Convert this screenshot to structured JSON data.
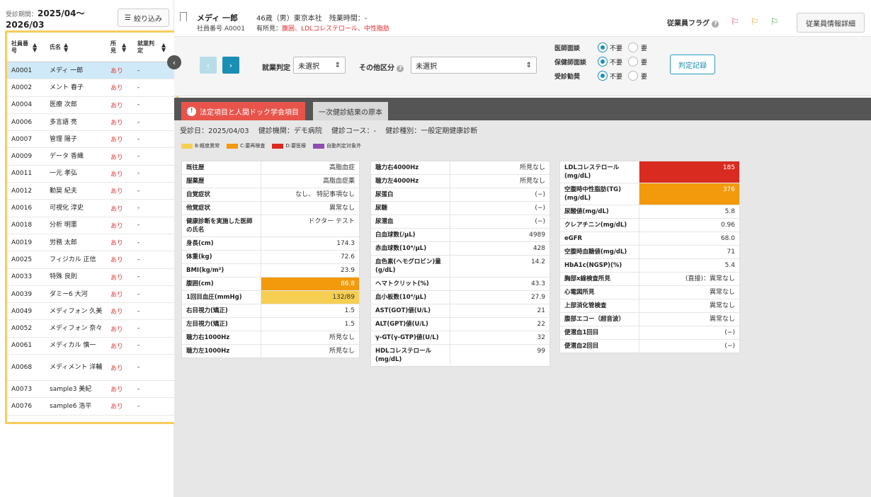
{
  "period": {
    "label": "受診期間：",
    "value1": "2025/04〜",
    "value2": "2026/03"
  },
  "filter_label": "絞り込み",
  "list": {
    "headers": {
      "id": "社員番号",
      "name": "氏名",
      "finding": "所見",
      "judge": "就業判定"
    },
    "rows": [
      {
        "id": "A0001",
        "name": "メディ 一郎",
        "finding": "あり",
        "judge": "-"
      },
      {
        "id": "A0002",
        "name": "メント 春子",
        "finding": "あり",
        "judge": "-"
      },
      {
        "id": "A0004",
        "name": "医療 次郎",
        "finding": "あり",
        "judge": "-"
      },
      {
        "id": "A0006",
        "name": "多言語 亮",
        "finding": "あり",
        "judge": "-"
      },
      {
        "id": "A0007",
        "name": "管理 陽子",
        "finding": "あり",
        "judge": "-"
      },
      {
        "id": "A0009",
        "name": "データ 香織",
        "finding": "あり",
        "judge": "-"
      },
      {
        "id": "A0011",
        "name": "一元 孝弘",
        "finding": "あり",
        "judge": "-"
      },
      {
        "id": "A0012",
        "name": "勤奨 紀夫",
        "finding": "あり",
        "judge": "-"
      },
      {
        "id": "A0016",
        "name": "可視化 淳史",
        "finding": "あり",
        "judge": "-"
      },
      {
        "id": "A0018",
        "name": "分析 明憲",
        "finding": "あり",
        "judge": "-"
      },
      {
        "id": "A0019",
        "name": "労務 太郎",
        "finding": "あり",
        "judge": "-"
      },
      {
        "id": "A0025",
        "name": "フィジカル 正信",
        "finding": "あり",
        "judge": "-"
      },
      {
        "id": "A0033",
        "name": "特殊 良則",
        "finding": "あり",
        "judge": "-"
      },
      {
        "id": "A0039",
        "name": "ダミー6 大河",
        "finding": "あり",
        "judge": "-"
      },
      {
        "id": "A0049",
        "name": "メディフォン 久美",
        "finding": "あり",
        "judge": "-"
      },
      {
        "id": "A0052",
        "name": "メディフォン 奈々",
        "finding": "あり",
        "judge": "-"
      },
      {
        "id": "A0061",
        "name": "メディカル 慎一",
        "finding": "あり",
        "judge": "-"
      },
      {
        "id": "A0068",
        "name": "メディメント 洋輔",
        "finding": "あり",
        "judge": "-"
      },
      {
        "id": "A0073",
        "name": "sample3 美紀",
        "finding": "あり",
        "judge": "-"
      },
      {
        "id": "A0076",
        "name": "sample6 浩平",
        "finding": "あり",
        "judge": "-"
      }
    ]
  },
  "employee": {
    "name": "メディ 一郎",
    "id_label": "社員番号 A0001",
    "info": "46歳（男）東京本社　残業時間：-",
    "findings_label": "有所見：",
    "findings": "腹囲、LDLコレステロール、中性脂肪"
  },
  "flags": {
    "label": "従業員フラグ",
    "colors": [
      "#e04060",
      "#f2990c",
      "#3aa63a"
    ]
  },
  "detail_button": "従業員情報詳細",
  "controls": {
    "judge_label": "就業判定",
    "judge_value": "未選択",
    "other_label": "その他区分",
    "other_value": "未選択",
    "radios": [
      {
        "label": "医師面談",
        "on": "不要",
        "off": "要"
      },
      {
        "label": "保健師面談",
        "on": "不要",
        "off": "要"
      },
      {
        "label": "受診勧奨",
        "on": "不要",
        "off": "要"
      }
    ],
    "record_button": "判定記録"
  },
  "tabs": {
    "tab1": "法定項目と人間ドック学会項目",
    "tab2": "一次健診結果の原本"
  },
  "exam_info": "受診日：2025/04/03　 健診機関：デモ病院　 健診コース：-　 健診種別：一般定期健康診断",
  "legend": [
    {
      "label": "B:軽度異常",
      "color": "#f6cf52"
    },
    {
      "label": "C:要再検査",
      "color": "#f2990c"
    },
    {
      "label": "D:要医療",
      "color": "#d92b20"
    },
    {
      "label": "自動判定対象外",
      "color": "#8e4db0"
    }
  ],
  "table1": [
    {
      "k": "既往歴",
      "v": "高脂血症",
      "c": ""
    },
    {
      "k": "服薬歴",
      "v": "高脂血症薬",
      "c": ""
    },
    {
      "k": "自覚症状",
      "v": "なし、 特記事項なし",
      "c": ""
    },
    {
      "k": "他覚症状",
      "v": "異常なし",
      "c": ""
    },
    {
      "k": "健康診断を実施した医師の氏名",
      "v": "ドクター テスト",
      "c": ""
    },
    {
      "k": "身長(cm)",
      "v": "174.3",
      "c": ""
    },
    {
      "k": "体重(kg)",
      "v": "72.6",
      "c": ""
    },
    {
      "k": "BMI(kg/m²)",
      "v": "23.9",
      "c": ""
    },
    {
      "k": "腹囲(cm)",
      "v": "86.8",
      "c": "orange"
    },
    {
      "k": "1回目血圧(mmHg)",
      "v": "132/89",
      "c": "yellow"
    },
    {
      "k": "右目視力(矯正)",
      "v": "1.5",
      "c": ""
    },
    {
      "k": "左目視力(矯正)",
      "v": "1.5",
      "c": ""
    },
    {
      "k": "聴力右1000Hz",
      "v": "所見なし",
      "c": ""
    },
    {
      "k": "聴力左1000Hz",
      "v": "所見なし",
      "c": ""
    }
  ],
  "table2": [
    {
      "k": "聴力右4000Hz",
      "v": "所見なし",
      "c": ""
    },
    {
      "k": "聴力左4000Hz",
      "v": "所見なし",
      "c": ""
    },
    {
      "k": "尿蛋白",
      "v": "(−)",
      "c": ""
    },
    {
      "k": "尿糖",
      "v": "(−)",
      "c": ""
    },
    {
      "k": "尿潜血",
      "v": "(−)",
      "c": ""
    },
    {
      "k": "白血球数(/μL)",
      "v": "4989",
      "c": ""
    },
    {
      "k": "赤血球数(10⁴/μL)",
      "v": "428",
      "c": ""
    },
    {
      "k": "血色素(ヘモグロビン)量(g/dL)",
      "v": "14.2",
      "c": ""
    },
    {
      "k": "ヘマトクリット(%)",
      "v": "43.3",
      "c": ""
    },
    {
      "k": "血小板数(10⁴/μL)",
      "v": "27.9",
      "c": ""
    },
    {
      "k": "AST(GOT)値(U/L)",
      "v": "21",
      "c": ""
    },
    {
      "k": "ALT(GPT)値(U/L)",
      "v": "22",
      "c": ""
    },
    {
      "k": "γ-GT(γ-GTP)値(U/L)",
      "v": "32",
      "c": ""
    },
    {
      "k": "HDLコレステロール(mg/dL)",
      "v": "99",
      "c": ""
    }
  ],
  "table3": [
    {
      "k": "LDLコレステロール(mg/dL)",
      "v": "185",
      "c": "red"
    },
    {
      "k": "空腹時中性脂肪(TG)(mg/dL)",
      "v": "376",
      "c": "orange"
    },
    {
      "k": "尿酸値(mg/dL)",
      "v": "5.8",
      "c": ""
    },
    {
      "k": "クレアチニン(mg/dL)",
      "v": "0.96",
      "c": ""
    },
    {
      "k": "eGFR",
      "v": "68.0",
      "c": ""
    },
    {
      "k": "空腹時血糖値(mg/dL)",
      "v": "71",
      "c": ""
    },
    {
      "k": "HbA1c(NGSP)(%)",
      "v": "5.4",
      "c": ""
    },
    {
      "k": "胸部x線検査所見",
      "v": "(直接)：異常なし",
      "c": ""
    },
    {
      "k": "心電図所見",
      "v": "異常なし",
      "c": ""
    },
    {
      "k": "上部消化管検査",
      "v": "異常なし",
      "c": ""
    },
    {
      "k": "腹部エコー（超音波）",
      "v": "異常なし",
      "c": ""
    },
    {
      "k": "便潜血1回目",
      "v": "(−)",
      "c": ""
    },
    {
      "k": "便潜血2回目",
      "v": "(−)",
      "c": ""
    }
  ]
}
